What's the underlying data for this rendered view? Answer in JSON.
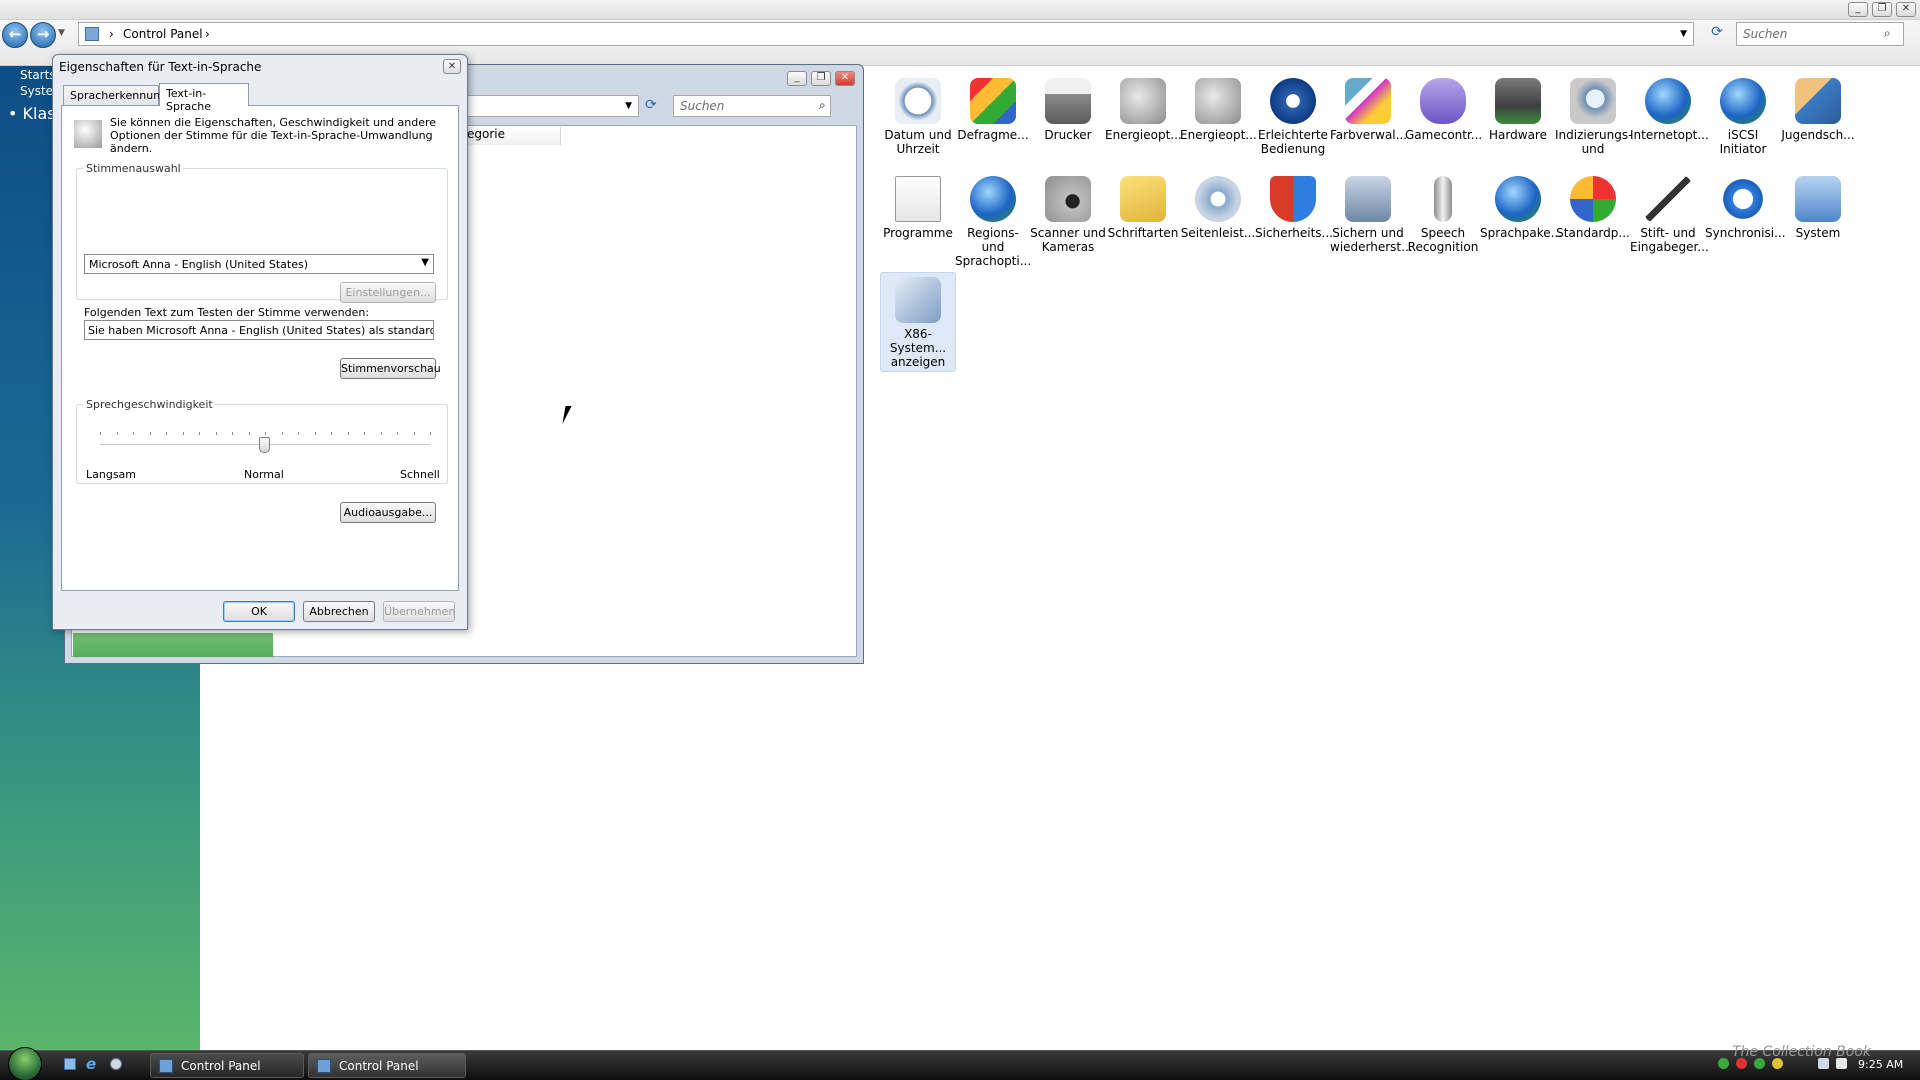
{
  "main": {
    "breadcrumb_root": "Control Panel",
    "search_placeholder": "Suchen"
  },
  "sidebar": {
    "item1": "Startseite",
    "item2": "Systemsteuerung",
    "item3": "Klassische Ansicht"
  },
  "icons": [
    {
      "label": "Datum und Uhrzeit"
    },
    {
      "label": "Defragme..."
    },
    {
      "label": "Drucker"
    },
    {
      "label": "Energieopt..."
    },
    {
      "label": "Energieopt..."
    },
    {
      "label": "Erleichterte Bedienung"
    },
    {
      "label": "Farbverwal..."
    },
    {
      "label": "Gamecontr..."
    },
    {
      "label": "Hardware"
    },
    {
      "label": "Indizierungs- und"
    },
    {
      "label": "Internetopt..."
    },
    {
      "label": "iSCSI Initiator"
    },
    {
      "label": "Jugendsch..."
    },
    {
      "label": "Programme"
    },
    {
      "label": "Regions- und Sprachopti..."
    },
    {
      "label": "Scanner und Kameras"
    },
    {
      "label": "Schriftarten"
    },
    {
      "label": "Seitenleist..."
    },
    {
      "label": "Sicherheits..."
    },
    {
      "label": "Sichern und wiederherst..."
    },
    {
      "label": "Speech Recognition"
    },
    {
      "label": "Sprachpake..."
    },
    {
      "label": "Standardp..."
    },
    {
      "label": "Stift- und Eingabeger..."
    },
    {
      "label": "Synchronisi..."
    },
    {
      "label": "System"
    },
    {
      "label": "X86-System... anzeigen"
    }
  ],
  "mid_window": {
    "search_placeholder": "Suchen",
    "column_header": "egorie"
  },
  "dialog": {
    "title": "Eigenschaften für Text-in-Sprache",
    "tab1": "Spracherkennung",
    "tab2": "Text-in-Sprache",
    "intro": "Sie können die Eigenschaften, Geschwindigkeit und andere Optionen der Stimme für die Text-in-Sprache-Umwandlung ändern.",
    "voice_group": "Stimmenauswahl",
    "voice_selected": "Microsoft Anna - English (United States)",
    "settings_button": "Einstellungen...",
    "test_label": "Folgenden Text zum Testen der Stimme verwenden:",
    "test_text": "Sie haben Microsoft Anna - English (United States) als standardmäßige St",
    "preview_button": "Stimmenvorschau",
    "speed_group": "Sprechgeschwindigkeit",
    "speed_slow": "Langsam",
    "speed_normal": "Normal",
    "speed_fast": "Schnell",
    "speed_value_fraction": 0.5,
    "audio_button": "Audioausgabe...",
    "ok_button": "OK",
    "cancel_button": "Abbrechen",
    "apply_button": "Übernehmen"
  },
  "taskbar": {
    "task1": "Control Panel",
    "task2": "Control Panel",
    "clock": "9:25 AM",
    "watermark": "The Collection Book"
  },
  "colors": {
    "accent": "#1f5fa5",
    "sidebar_top": "#0c4d86",
    "sidebar_bottom": "#5bb56a"
  }
}
